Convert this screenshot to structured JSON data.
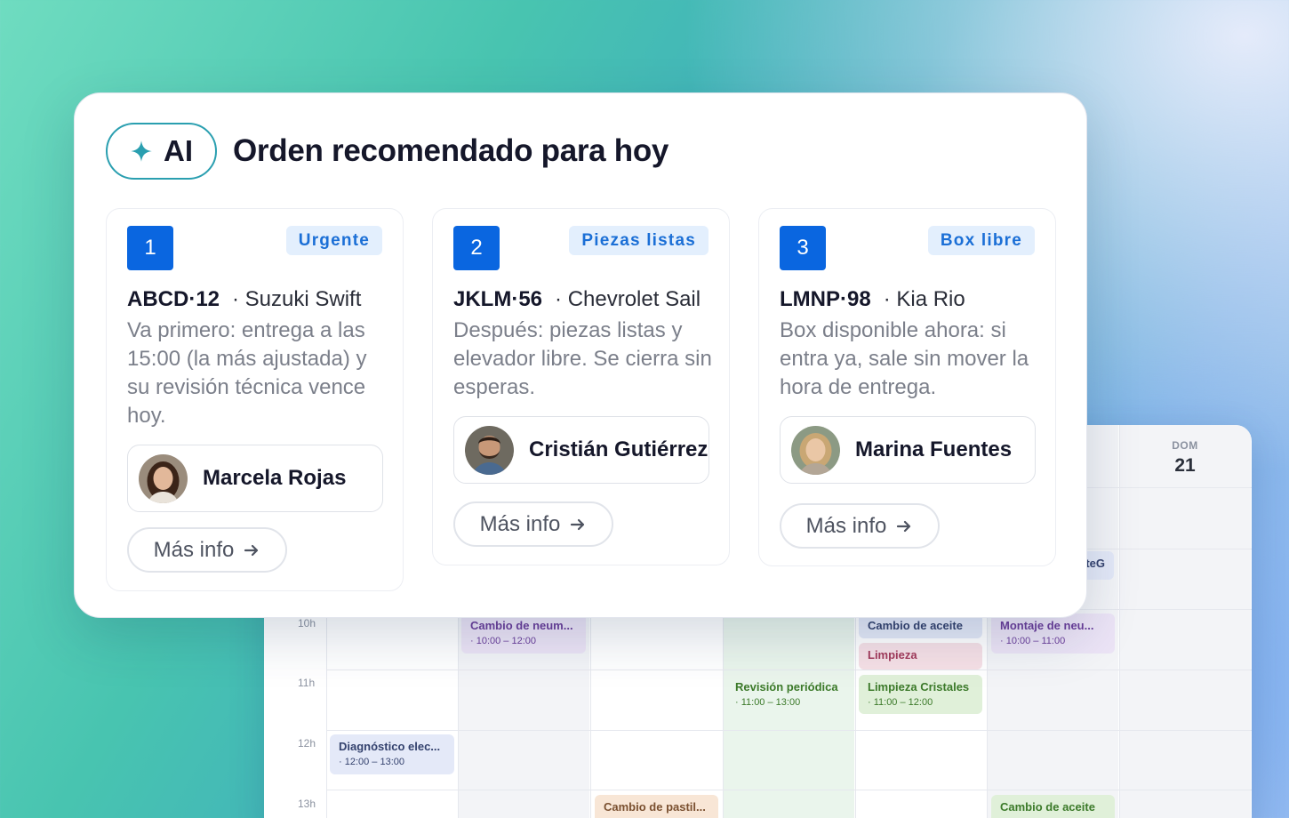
{
  "header": {
    "ai_label": "AI",
    "title": "Orden recomendado para hoy"
  },
  "recommendations": [
    {
      "rank": "1",
      "badge": "Urgente",
      "plate": "ABCD·12",
      "model": "· Suzuki Swift",
      "description": "Va primero: entrega a las 15:00 (la más ajustada) y su revisión técnica vence hoy.",
      "technician": "Marcela Rojas",
      "more_label": "Más info"
    },
    {
      "rank": "2",
      "badge": "Piezas listas",
      "plate": "JKLM·56",
      "model": "· Chevrolet Sail",
      "description": "Después: piezas listas y elevador libre. Se cierra sin esperas.",
      "technician": "Cristián Gutiérrez",
      "more_label": "Más info"
    },
    {
      "rank": "3",
      "badge": "Box libre",
      "plate": "LMNP·98",
      "model": "· Kia Rio",
      "description": "Box disponible ahora: si entra ya, sale sin mover la hora de entrega.",
      "technician": "Marina Fuentes",
      "more_label": "Más info"
    }
  ],
  "calendar": {
    "day_name": "DOM",
    "day_num": "21",
    "hours": [
      "10h",
      "11h",
      "12h",
      "13h"
    ],
    "events": {
      "e1_title": "Cambio de neum...",
      "e1_time": "· 10:00 – 12:00",
      "e2_title": "Cambio de aceite",
      "e3_title": "Limpieza",
      "e4_title": "Montaje de neu...",
      "e4_time": "· 10:00 – 11:00",
      "e5_title": "Revisión periódica",
      "e5_time": "· 11:00 – 13:00",
      "e6_title": "Limpieza Cristales",
      "e6_time": "· 11:00 – 12:00",
      "e7_title": "Diagnóstico elec...",
      "e7_time": "· 12:00 – 13:00",
      "e8_title": "Cambio de pastil...",
      "e9_title": "Cambio de aceite",
      "e10_title": "teG"
    }
  },
  "colors": {
    "accent": "#0a66e0",
    "badge_bg": "#e3effd",
    "ai_border": "#2a9fb0"
  }
}
